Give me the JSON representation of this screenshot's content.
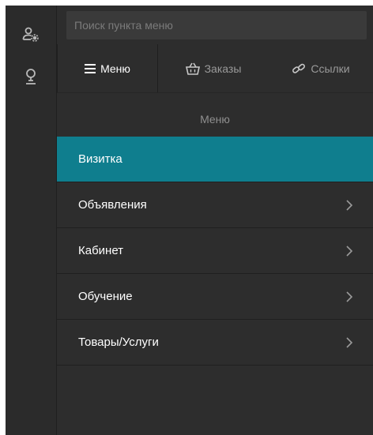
{
  "search": {
    "placeholder": "Поиск пункта меню",
    "value": ""
  },
  "tabs": [
    {
      "label": "Меню",
      "icon": "hamburger-icon",
      "active": true
    },
    {
      "label": "Заказы",
      "icon": "basket-icon",
      "active": false
    },
    {
      "label": "Ссылки",
      "icon": "link-icon",
      "active": false
    }
  ],
  "section": {
    "title": "Меню"
  },
  "menu": {
    "items": [
      {
        "label": "Визитка",
        "active": true,
        "has_children": false
      },
      {
        "label": "Объявления",
        "active": false,
        "has_children": true
      },
      {
        "label": "Кабинет",
        "active": false,
        "has_children": true
      },
      {
        "label": "Обучение",
        "active": false,
        "has_children": true
      },
      {
        "label": "Товары/Услуги",
        "active": false,
        "has_children": true
      }
    ]
  },
  "rail": {
    "icons": [
      "user-settings-icon",
      "map-pin-icon"
    ]
  },
  "colors": {
    "background": "#2d2d2d",
    "rail": "#2b2b2b",
    "accent": "#0f7e8e",
    "search_bg": "#3a3a3a",
    "text": "#ffffff",
    "muted_text": "#9a9a9a"
  }
}
